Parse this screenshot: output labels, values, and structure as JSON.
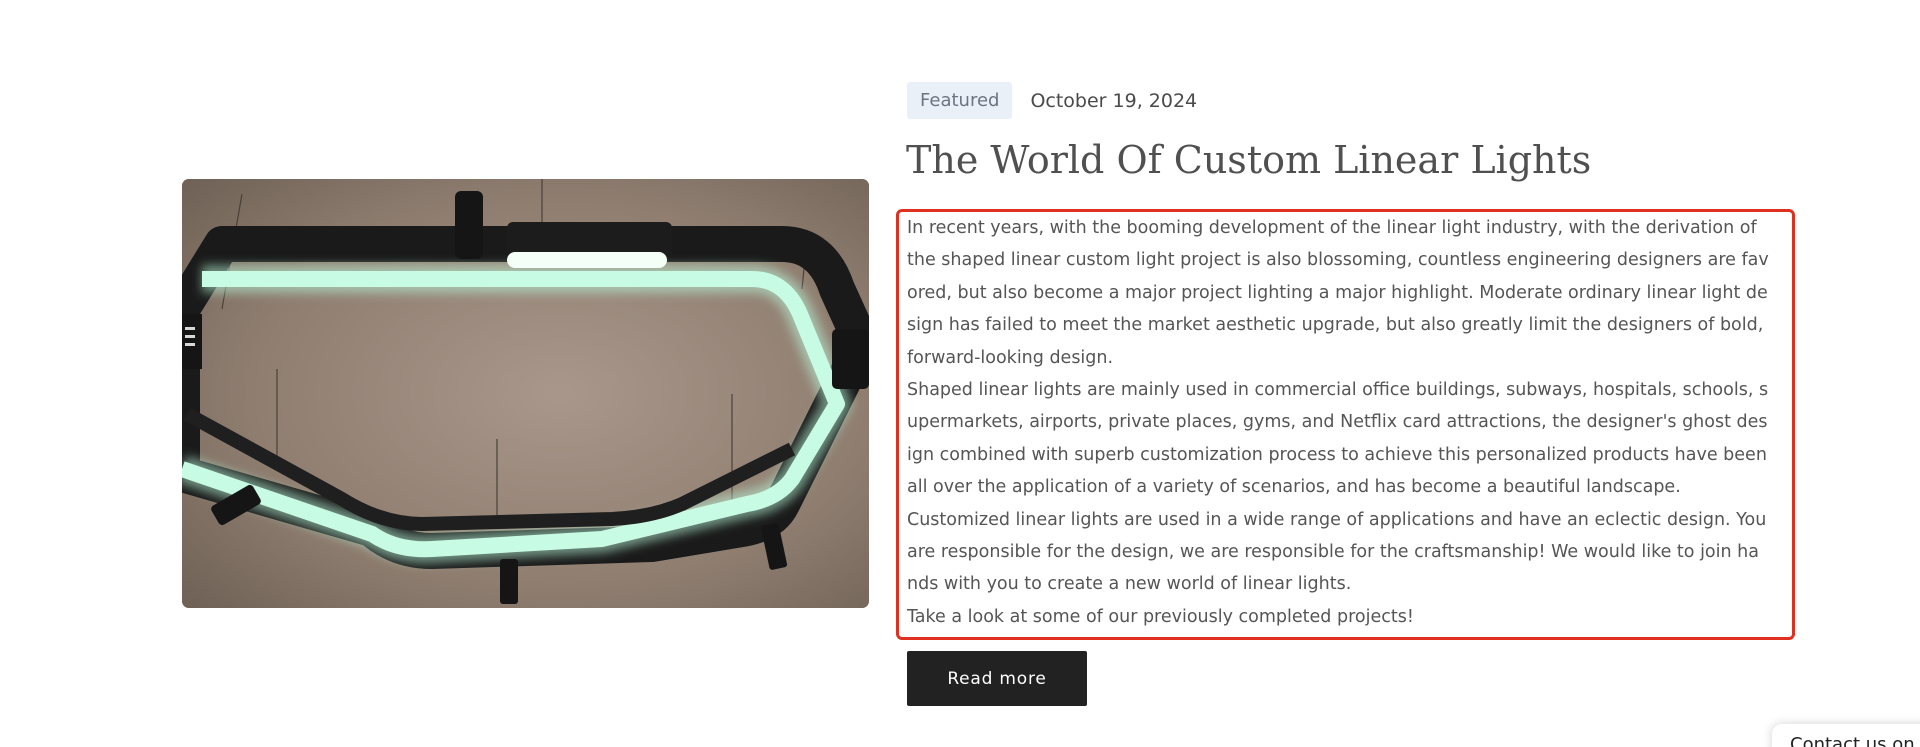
{
  "article": {
    "image_alt": "Hexagonal shaped linear light fixture",
    "category": "Featured",
    "date": "October 19, 2024",
    "title": "The World Of Custom Linear Lights",
    "paragraphs": [
      "In recent years, with the booming development of the linear light industry, with the derivation of  the shaped linear custom light project is also blossoming, countless engineering designers are favored, but also become a major project lighting a major highlight. Moderate ordinary linear light design has failed to meet the market aesthetic upgrade, but also greatly limit the designers of bold, forward-looking design.",
      "Shaped linear lights are mainly used in commercial office buildings, subways, hospitals, schools, supermarkets, airports, private places, gyms, and Netflix card attractions, the designer's ghost design combined with superb customization process to achieve this personalized products have been all over the application of a variety of scenarios, and has become a beautiful landscape.",
      "Customized linear lights are used in a wide range of applications and have an eclectic design. You are responsible for the design, we are responsible for the craftsmanship! We would like to join hands with you to create a new world of linear lights.",
      "Take a look at some of our previously completed projects!"
    ],
    "read_more_label": "Read more"
  },
  "contact": {
    "label": "Contact us on"
  },
  "colors": {
    "highlight": "#e03020",
    "button": "#222222",
    "badge_bg": "#e9f0f8",
    "glow": "#b8f5d8"
  }
}
